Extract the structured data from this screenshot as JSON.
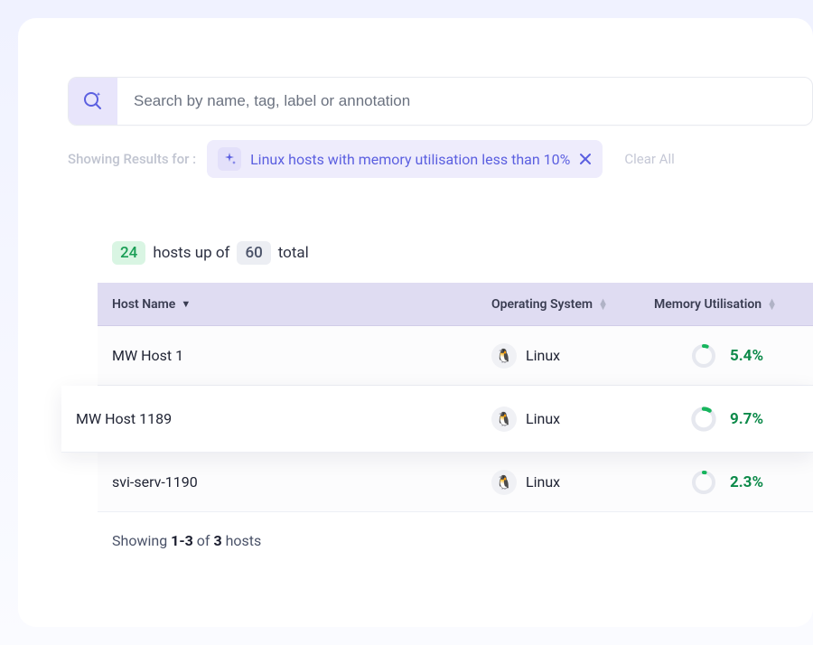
{
  "search": {
    "placeholder": "Search by name, tag, label or annotation",
    "value": ""
  },
  "filter": {
    "showing_label": "Showing Results for :",
    "chip_text": "Linux hosts with memory utilisation less than 10%",
    "clear_all": "Clear All"
  },
  "summary": {
    "up_count": "24",
    "mid_text_1": "hosts up of",
    "total_count": "60",
    "mid_text_2": "total"
  },
  "columns": {
    "host": "Host Name",
    "os": "Operating System",
    "mem": "Memory Utilisation"
  },
  "rows": [
    {
      "host": "MW Host 1",
      "os": "Linux",
      "memory_pct": 5.4,
      "memory_label": "5.4%",
      "highlight": false
    },
    {
      "host": "MW Host 1189",
      "os": "Linux",
      "memory_pct": 9.7,
      "memory_label": "9.7%",
      "highlight": true
    },
    {
      "host": "svi-serv-1190",
      "os": "Linux",
      "memory_pct": 2.3,
      "memory_label": "2.3%",
      "highlight": false
    }
  ],
  "pagination": {
    "prefix": "Showing",
    "range": "1-3",
    "of": "of",
    "total": "3",
    "suffix": "hosts"
  },
  "icons": {
    "search": "search-sparkle-icon",
    "sparkle": "sparkle-icon",
    "close": "close-icon",
    "linux": "linux-icon"
  },
  "colors": {
    "accent": "#5b5fe0",
    "green": "#0d8a4a",
    "chip_bg": "#eeecfc"
  }
}
